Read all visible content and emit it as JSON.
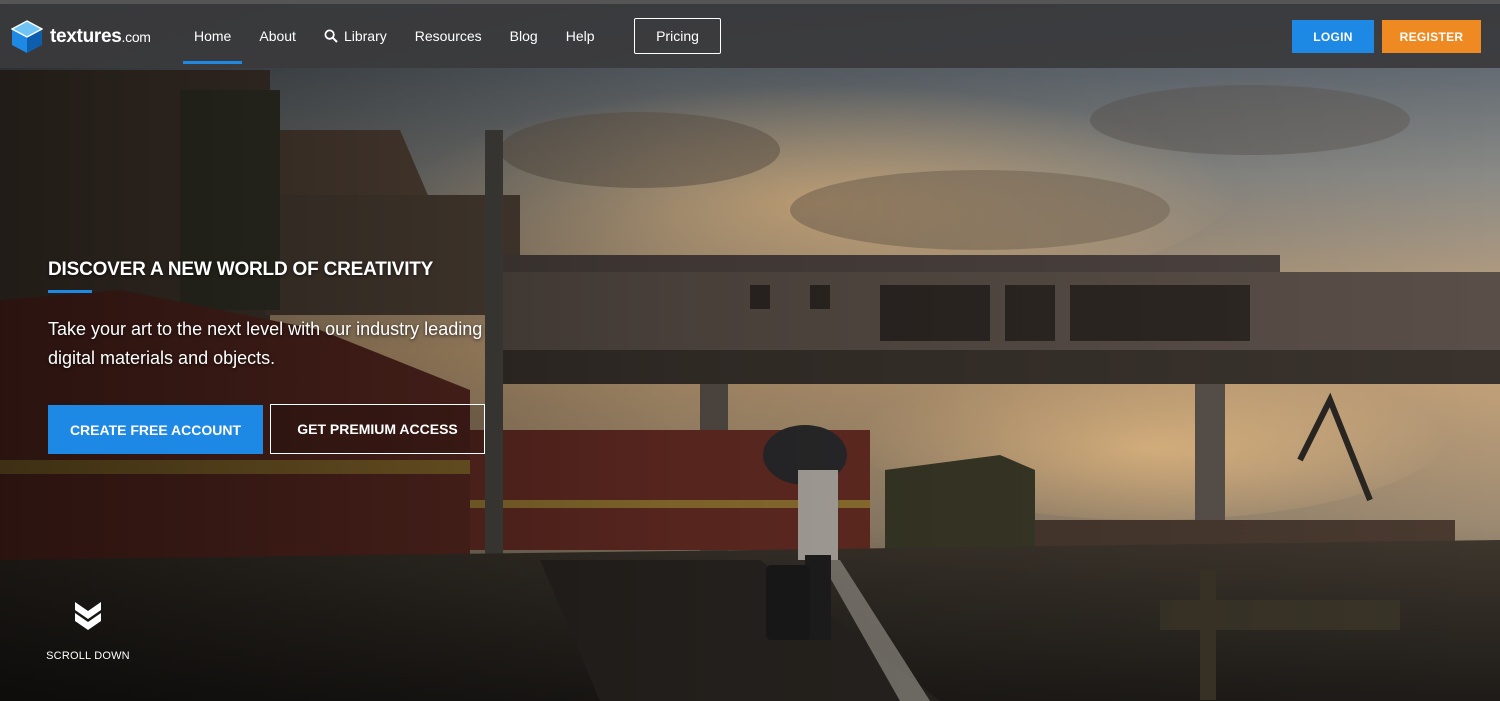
{
  "brand": {
    "name": "textures",
    "tld": ".com",
    "colors": {
      "primary": "#1e88e5",
      "accent": "#ef8a23"
    }
  },
  "nav": {
    "items": [
      {
        "label": "Home",
        "active": true
      },
      {
        "label": "About"
      },
      {
        "label": "Library",
        "icon": "search-icon"
      },
      {
        "label": "Resources"
      },
      {
        "label": "Blog"
      },
      {
        "label": "Help"
      }
    ],
    "pricing_label": "Pricing",
    "login_label": "LOGIN",
    "register_label": "REGISTER"
  },
  "hero": {
    "headline": "DISCOVER A NEW WORLD OF CREATIVITY",
    "subtext": "Take your art to the next level with our industry leading digital materials and objects.",
    "cta_primary": "CREATE FREE ACCOUNT",
    "cta_secondary": "GET PREMIUM ACCESS",
    "scroll_label": "SCROLL DOWN",
    "scroll_icon": "chevron-double-down-icon"
  }
}
